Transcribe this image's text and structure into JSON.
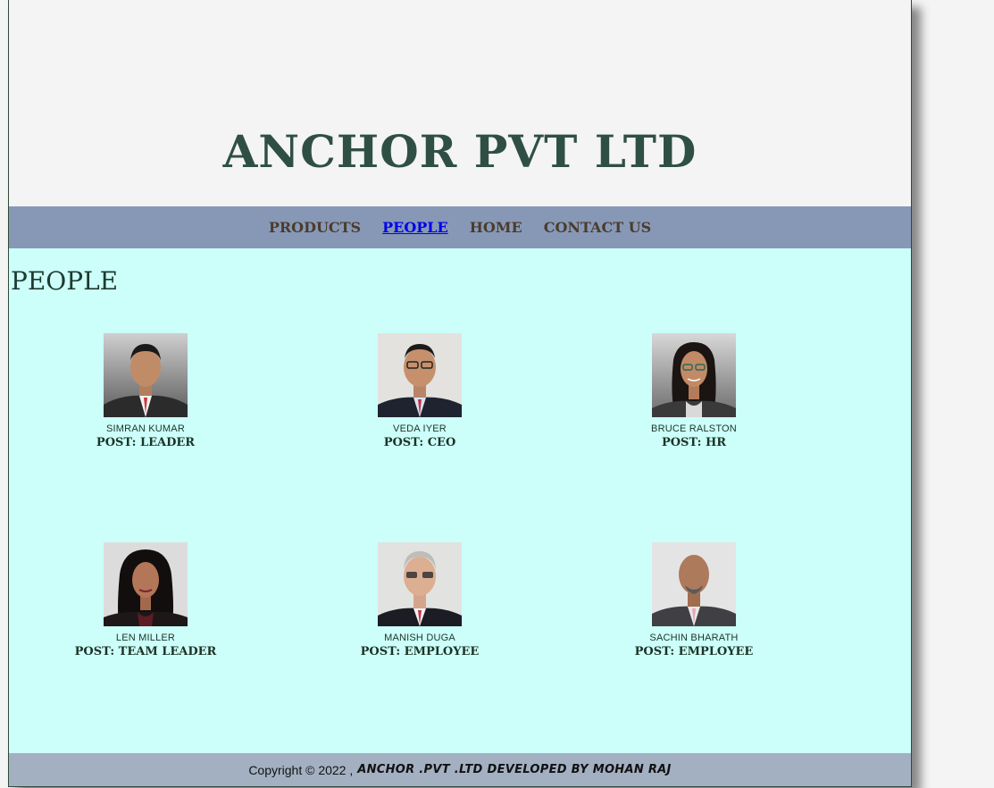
{
  "header": {
    "title": "ANCHOR PVT LTD"
  },
  "nav": {
    "items": [
      {
        "label": "PRODUCTS",
        "active": false
      },
      {
        "label": "PEOPLE",
        "active": true
      },
      {
        "label": "HOME",
        "active": false
      },
      {
        "label": "CONTACT US",
        "active": false
      }
    ]
  },
  "main": {
    "heading": "PEOPLE",
    "people": [
      {
        "name": "SIMRAN KUMAR",
        "post": "POST: LEADER"
      },
      {
        "name": "VEDA IYER",
        "post": "POST: CEO"
      },
      {
        "name": "BRUCE RALSTON",
        "post": "POST: HR"
      },
      {
        "name": "LEN MILLER",
        "post": "POST: TEAM LEADER"
      },
      {
        "name": "MANISH DUGA",
        "post": "POST: EMPLOYEE"
      },
      {
        "name": "SACHIN BHARATH",
        "post": "POST: EMPLOYEE"
      }
    ]
  },
  "footer": {
    "copyright": "Copyright © 2022 ,",
    "credit": "ANCHOR .PVT .LTD DEVELOPED BY MOHAN RAJ"
  },
  "colors": {
    "header_bg": "#f4f4f4",
    "title": "#2f4f45",
    "nav_bg": "#8798b7",
    "nav_link": "#4b3c2c",
    "nav_active": "#0000ee",
    "main_bg": "#ccfffa",
    "footer_bg": "#a3b0c2"
  }
}
